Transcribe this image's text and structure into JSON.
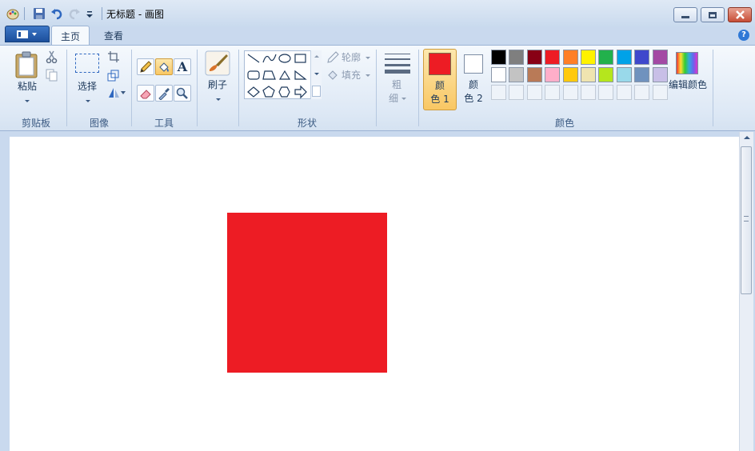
{
  "window": {
    "title": "无标题 - 画图"
  },
  "tabs": [
    {
      "label": "主页",
      "active": true
    },
    {
      "label": "查看",
      "active": false
    }
  ],
  "help_icon_glyph": "?",
  "groups": {
    "clipboard": {
      "label": "剪贴板",
      "paste": "粘贴"
    },
    "image": {
      "label": "图像",
      "select": "选择"
    },
    "tools": {
      "label": "工具",
      "text_glyph": "A"
    },
    "brushes": {
      "label": "刷子"
    },
    "shapes": {
      "label": "形状",
      "outline": "轮廓",
      "fill": "填充"
    },
    "size": {
      "line1": "粗",
      "line2": "细"
    },
    "colors": {
      "label": "颜色",
      "color1_line1": "颜",
      "color1_line2": "色 1",
      "color2_line1": "颜",
      "color2_line2": "色 2",
      "edit": "编辑颜色",
      "color1_value": "#ed1c24",
      "color2_value": "#ffffff",
      "palette_row1": [
        "#000000",
        "#7f7f7f",
        "#880015",
        "#ed1c24",
        "#ff7f27",
        "#fff200",
        "#22b14c",
        "#00a2e8",
        "#3f48cc",
        "#a349a4"
      ],
      "palette_row2": [
        "#ffffff",
        "#c3c3c3",
        "#b97a57",
        "#ffaec9",
        "#ffc90e",
        "#efe4b0",
        "#b5e61d",
        "#99d9ea",
        "#7092be",
        "#c8bfe7"
      ]
    }
  },
  "canvas": {
    "shape_color": "#ed1c24"
  }
}
